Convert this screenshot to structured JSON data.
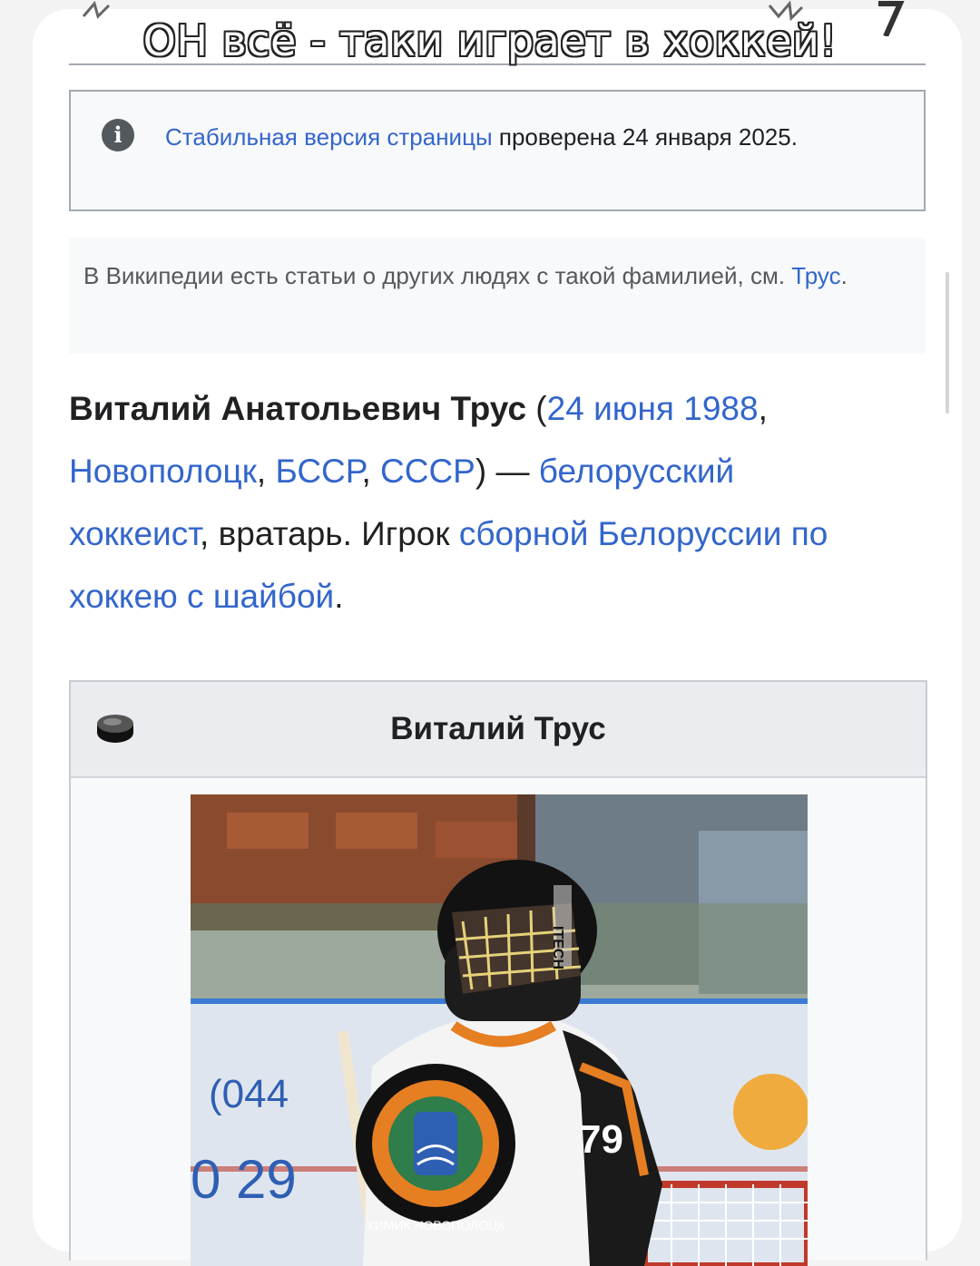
{
  "caption": "ОН всё - таки играет в хоккей!",
  "notice": {
    "icon": "info-icon",
    "link": "Стабильная версия страницы",
    "text": " проверена 24 января 2025."
  },
  "hatnote": {
    "text": "В Википедии есть статьи о других людях с такой фамилией, см. ",
    "link": "Трус",
    "end": "."
  },
  "lead": {
    "name": "Виталий Анатольевич Трус",
    "open": " (",
    "date_link": "24 июня 1988",
    "comma1": ", ",
    "city_link": "Новополоцк",
    "comma2": ", ",
    "bssr_link": "БССР",
    "comma3": ", ",
    "ussr_link": "СССР",
    "dash": ") — ",
    "nationality_link": "белорусский",
    "space": " ",
    "sport_link": "хоккеист",
    "role": ", вратарь. Игрок ",
    "team_link": "сборной Белоруссии по хоккею с шайбой",
    "end": "."
  },
  "infobox": {
    "icon": "hockey-puck-icon",
    "title": "Виталий Трус",
    "photo": {
      "jersey_number": "79",
      "banner_text_1": "(044",
      "banner_text_2": "0 29",
      "crest_text": "ХИМИК НОВОПОЛОЦК"
    }
  },
  "colors": {
    "link": "#3366cc",
    "text": "#202122",
    "muted": "#54595d",
    "border": "#a2a9b1"
  }
}
